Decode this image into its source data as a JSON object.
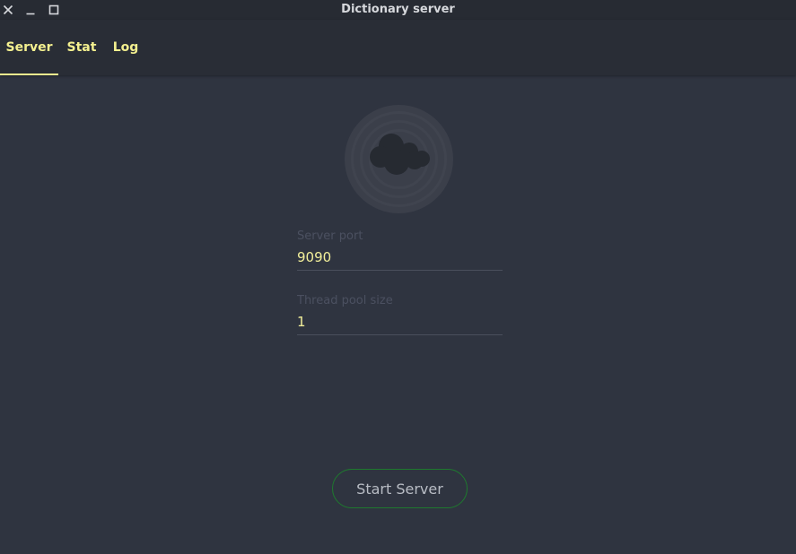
{
  "window": {
    "title": "Dictionary server",
    "controls": [
      "close-icon",
      "minimize-icon",
      "maximize-icon"
    ]
  },
  "tabs": [
    {
      "label": "Server",
      "active": true
    },
    {
      "label": "Stat",
      "active": false
    },
    {
      "label": "Log",
      "active": false
    }
  ],
  "logo": {
    "icon": "cloud-icon"
  },
  "form": {
    "port": {
      "label": "Server port",
      "value": "9090"
    },
    "pool": {
      "label": "Thread pool size",
      "value": "1"
    }
  },
  "actions": {
    "start_label": "Start Server"
  },
  "colors": {
    "background": "#2f3440",
    "accent": "#f4f08f",
    "button_border": "#1e7a2e"
  }
}
